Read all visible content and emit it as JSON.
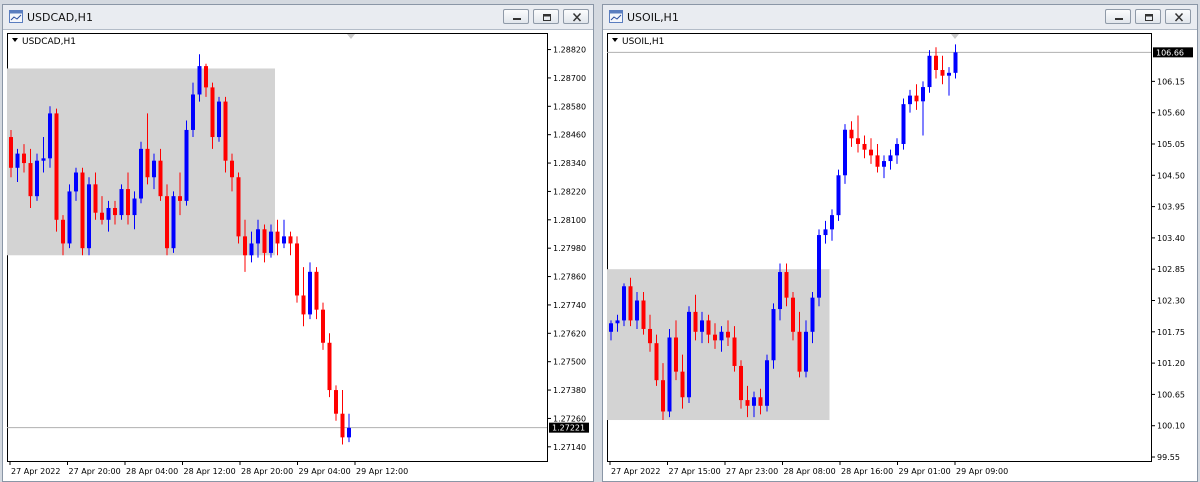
{
  "windows": [
    {
      "id": "usdcad",
      "title": "USDCAD,H1",
      "chart_label": "USDCAD,H1",
      "current_price": "1.27221",
      "chart_data": {
        "type": "candlestick",
        "symbol": "USDCAD",
        "timeframe": "H1",
        "y_ticks": [
          "1.28820",
          "1.28700",
          "1.28580",
          "1.28460",
          "1.28340",
          "1.28220",
          "1.28100",
          "1.27980",
          "1.27860",
          "1.27740",
          "1.27620",
          "1.27500",
          "1.27380",
          "1.27260",
          "1.27140"
        ],
        "x_ticks": [
          "27 Apr 2022",
          "27 Apr 20:00",
          "28 Apr 04:00",
          "28 Apr 12:00",
          "28 Apr 20:00",
          "29 Apr 04:00",
          "29 Apr 12:00"
        ],
        "ylim": [
          1.2708,
          1.2889
        ],
        "current_price": 1.27221,
        "shaded_range": {
          "from_bar": 0,
          "to_bar": 40,
          "low": 1.2795,
          "high": 1.2874
        },
        "colors": {
          "up": "#0000ff",
          "down": "#ff0000",
          "shade": "#d3d3d3"
        },
        "ohlc": [
          [
            1.2845,
            1.2848,
            1.2828,
            1.2832
          ],
          [
            1.2832,
            1.284,
            1.2826,
            1.2838
          ],
          [
            1.2838,
            1.2842,
            1.283,
            1.2834
          ],
          [
            1.2834,
            1.284,
            1.2815,
            1.282
          ],
          [
            1.282,
            1.2838,
            1.2818,
            1.2835
          ],
          [
            1.2835,
            1.2845,
            1.283,
            1.2836
          ],
          [
            1.2836,
            1.2858,
            1.2832,
            1.2855
          ],
          [
            1.2855,
            1.2857,
            1.2805,
            1.281
          ],
          [
            1.281,
            1.2812,
            1.2795,
            1.28
          ],
          [
            1.28,
            1.2825,
            1.2798,
            1.2822
          ],
          [
            1.2822,
            1.2832,
            1.2818,
            1.283
          ],
          [
            1.283,
            1.2832,
            1.2795,
            1.2798
          ],
          [
            1.2798,
            1.2828,
            1.2795,
            1.2825
          ],
          [
            1.2825,
            1.283,
            1.281,
            1.2813
          ],
          [
            1.2813,
            1.282,
            1.2808,
            1.281
          ],
          [
            1.281,
            1.2818,
            1.2805,
            1.2815
          ],
          [
            1.2815,
            1.2818,
            1.2808,
            1.2812
          ],
          [
            1.2812,
            1.2825,
            1.281,
            1.2823
          ],
          [
            1.2823,
            1.283,
            1.2808,
            1.2812
          ],
          [
            1.2812,
            1.2822,
            1.2806,
            1.2819
          ],
          [
            1.2819,
            1.2843,
            1.2817,
            1.284
          ],
          [
            1.284,
            1.2855,
            1.2825,
            1.2828
          ],
          [
            1.2828,
            1.2838,
            1.2823,
            1.2835
          ],
          [
            1.2835,
            1.284,
            1.2818,
            1.282
          ],
          [
            1.282,
            1.2825,
            1.2795,
            1.2798
          ],
          [
            1.2798,
            1.2822,
            1.2796,
            1.282
          ],
          [
            1.282,
            1.283,
            1.2812,
            1.2818
          ],
          [
            1.2818,
            1.2852,
            1.2816,
            1.2848
          ],
          [
            1.2848,
            1.2868,
            1.2845,
            1.2863
          ],
          [
            1.2863,
            1.288,
            1.286,
            1.2875
          ],
          [
            1.2875,
            1.2876,
            1.2862,
            1.2866
          ],
          [
            1.2866,
            1.2868,
            1.284,
            1.2845
          ],
          [
            1.2845,
            1.2862,
            1.2843,
            1.286
          ],
          [
            1.286,
            1.2862,
            1.283,
            1.2835
          ],
          [
            1.2835,
            1.2838,
            1.2822,
            1.2828
          ],
          [
            1.2828,
            1.283,
            1.28,
            1.2803
          ],
          [
            1.2803,
            1.281,
            1.2788,
            1.2795
          ],
          [
            1.2795,
            1.2805,
            1.2792,
            1.28
          ],
          [
            1.28,
            1.281,
            1.2794,
            1.2806
          ],
          [
            1.2806,
            1.2808,
            1.2792,
            1.2796
          ],
          [
            1.2796,
            1.2808,
            1.2794,
            1.2805
          ],
          [
            1.2805,
            1.281,
            1.2795,
            1.28
          ],
          [
            1.28,
            1.281,
            1.2798,
            1.2803
          ],
          [
            1.2803,
            1.2805,
            1.2795,
            1.28
          ],
          [
            1.28,
            1.2803,
            1.2775,
            1.2778
          ],
          [
            1.2778,
            1.279,
            1.2765,
            1.277
          ],
          [
            1.277,
            1.2792,
            1.2768,
            1.2788
          ],
          [
            1.2788,
            1.279,
            1.2768,
            1.2772
          ],
          [
            1.2772,
            1.2775,
            1.2755,
            1.2758
          ],
          [
            1.2758,
            1.2762,
            1.2735,
            1.2738
          ],
          [
            1.2738,
            1.274,
            1.2725,
            1.2728
          ],
          [
            1.2728,
            1.2738,
            1.2715,
            1.2718
          ],
          [
            1.2718,
            1.2728,
            1.2716,
            1.2722
          ]
        ]
      }
    },
    {
      "id": "usoil",
      "title": "USOIL,H1",
      "chart_label": "USOIL,H1",
      "current_price": "106.66",
      "chart_data": {
        "type": "candlestick",
        "symbol": "USOIL",
        "timeframe": "H1",
        "y_ticks": [
          "106.15",
          "105.60",
          "105.05",
          "104.50",
          "103.95",
          "103.40",
          "102.85",
          "102.30",
          "101.75",
          "101.20",
          "100.65",
          "100.10",
          "99.55"
        ],
        "x_ticks": [
          "27 Apr 2022",
          "27 Apr 15:00",
          "27 Apr 23:00",
          "28 Apr 08:00",
          "28 Apr 16:00",
          "29 Apr 01:00",
          "29 Apr 09:00"
        ],
        "ylim": [
          99.48,
          107.0
        ],
        "current_price": 106.66,
        "shaded_range": {
          "from_bar": 0,
          "to_bar": 33,
          "low": 100.2,
          "high": 102.85
        },
        "colors": {
          "up": "#0000ff",
          "down": "#ff0000",
          "shade": "#d3d3d3"
        },
        "ohlc": [
          [
            101.75,
            101.95,
            101.6,
            101.9
          ],
          [
            101.9,
            102.05,
            101.75,
            101.95
          ],
          [
            101.95,
            102.6,
            101.85,
            102.55
          ],
          [
            102.55,
            102.7,
            101.85,
            101.95
          ],
          [
            101.95,
            102.45,
            101.8,
            102.3
          ],
          [
            102.3,
            102.45,
            101.7,
            101.8
          ],
          [
            101.8,
            102.05,
            101.4,
            101.55
          ],
          [
            101.55,
            101.7,
            100.8,
            100.9
          ],
          [
            100.9,
            101.2,
            100.2,
            100.35
          ],
          [
            100.35,
            101.8,
            100.25,
            101.65
          ],
          [
            101.65,
            101.95,
            100.9,
            101.05
          ],
          [
            101.05,
            101.35,
            100.4,
            100.6
          ],
          [
            100.6,
            102.2,
            100.5,
            102.1
          ],
          [
            102.1,
            102.4,
            101.6,
            101.75
          ],
          [
            101.75,
            102.1,
            101.55,
            101.95
          ],
          [
            101.95,
            102.05,
            101.55,
            101.7
          ],
          [
            101.7,
            101.9,
            101.45,
            101.6
          ],
          [
            101.6,
            101.85,
            101.4,
            101.75
          ],
          [
            101.75,
            101.95,
            101.5,
            101.65
          ],
          [
            101.65,
            101.85,
            101.05,
            101.15
          ],
          [
            101.15,
            101.25,
            100.4,
            100.55
          ],
          [
            100.55,
            100.8,
            100.25,
            100.45
          ],
          [
            100.45,
            100.7,
            100.25,
            100.6
          ],
          [
            100.6,
            100.75,
            100.3,
            100.45
          ],
          [
            100.45,
            101.35,
            100.35,
            101.25
          ],
          [
            101.25,
            102.25,
            101.1,
            102.15
          ],
          [
            102.15,
            102.95,
            101.95,
            102.8
          ],
          [
            102.8,
            102.95,
            102.2,
            102.35
          ],
          [
            102.35,
            102.45,
            101.6,
            101.75
          ],
          [
            101.75,
            102.1,
            100.95,
            101.05
          ],
          [
            101.05,
            101.95,
            100.95,
            101.75
          ],
          [
            101.75,
            102.45,
            101.55,
            102.35
          ],
          [
            102.35,
            103.55,
            102.2,
            103.45
          ],
          [
            103.45,
            103.7,
            103.3,
            103.55
          ],
          [
            103.55,
            103.9,
            103.35,
            103.8
          ],
          [
            103.8,
            104.6,
            103.7,
            104.5
          ],
          [
            104.5,
            105.4,
            104.35,
            105.3
          ],
          [
            105.3,
            105.45,
            105.0,
            105.15
          ],
          [
            105.15,
            105.55,
            104.9,
            105.05
          ],
          [
            105.05,
            105.2,
            104.8,
            104.95
          ],
          [
            104.95,
            105.15,
            104.7,
            104.85
          ],
          [
            104.85,
            105.05,
            104.55,
            104.65
          ],
          [
            104.65,
            104.85,
            104.45,
            104.75
          ],
          [
            104.75,
            104.95,
            104.6,
            104.85
          ],
          [
            104.85,
            105.15,
            104.7,
            105.05
          ],
          [
            105.05,
            105.85,
            104.95,
            105.75
          ],
          [
            105.75,
            106.0,
            105.6,
            105.9
          ],
          [
            105.9,
            106.1,
            105.65,
            105.8
          ],
          [
            105.8,
            106.15,
            105.2,
            106.05
          ],
          [
            106.05,
            106.7,
            105.95,
            106.6
          ],
          [
            106.6,
            106.75,
            106.2,
            106.35
          ],
          [
            106.35,
            106.6,
            106.1,
            106.25
          ],
          [
            106.25,
            106.4,
            105.9,
            106.3
          ],
          [
            106.3,
            106.8,
            106.2,
            106.66
          ]
        ]
      }
    }
  ]
}
